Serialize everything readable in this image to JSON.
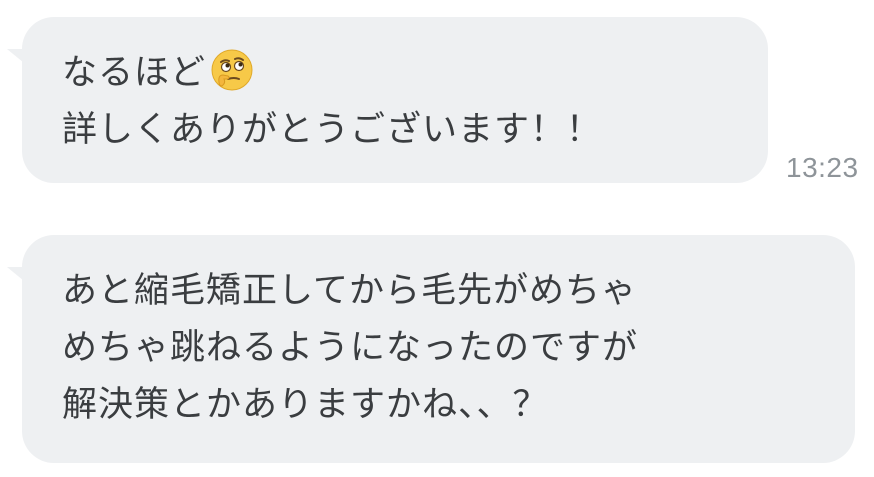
{
  "chat": {
    "messages": [
      {
        "lines": [
          "なるほど",
          "詳しくありがとうございます！！"
        ],
        "emoji": "thinking-face",
        "time": "13:23"
      },
      {
        "lines": [
          "あと縮毛矯正してから毛先がめちゃ",
          "めちゃ跳ねるようになったのですが",
          "解決策とかありますかね、、？"
        ]
      }
    ]
  },
  "colors": {
    "bubble": "#eef0f2",
    "text": "#3a3d40",
    "timestamp": "#8e9499",
    "emoji_face": "#f7c948"
  }
}
